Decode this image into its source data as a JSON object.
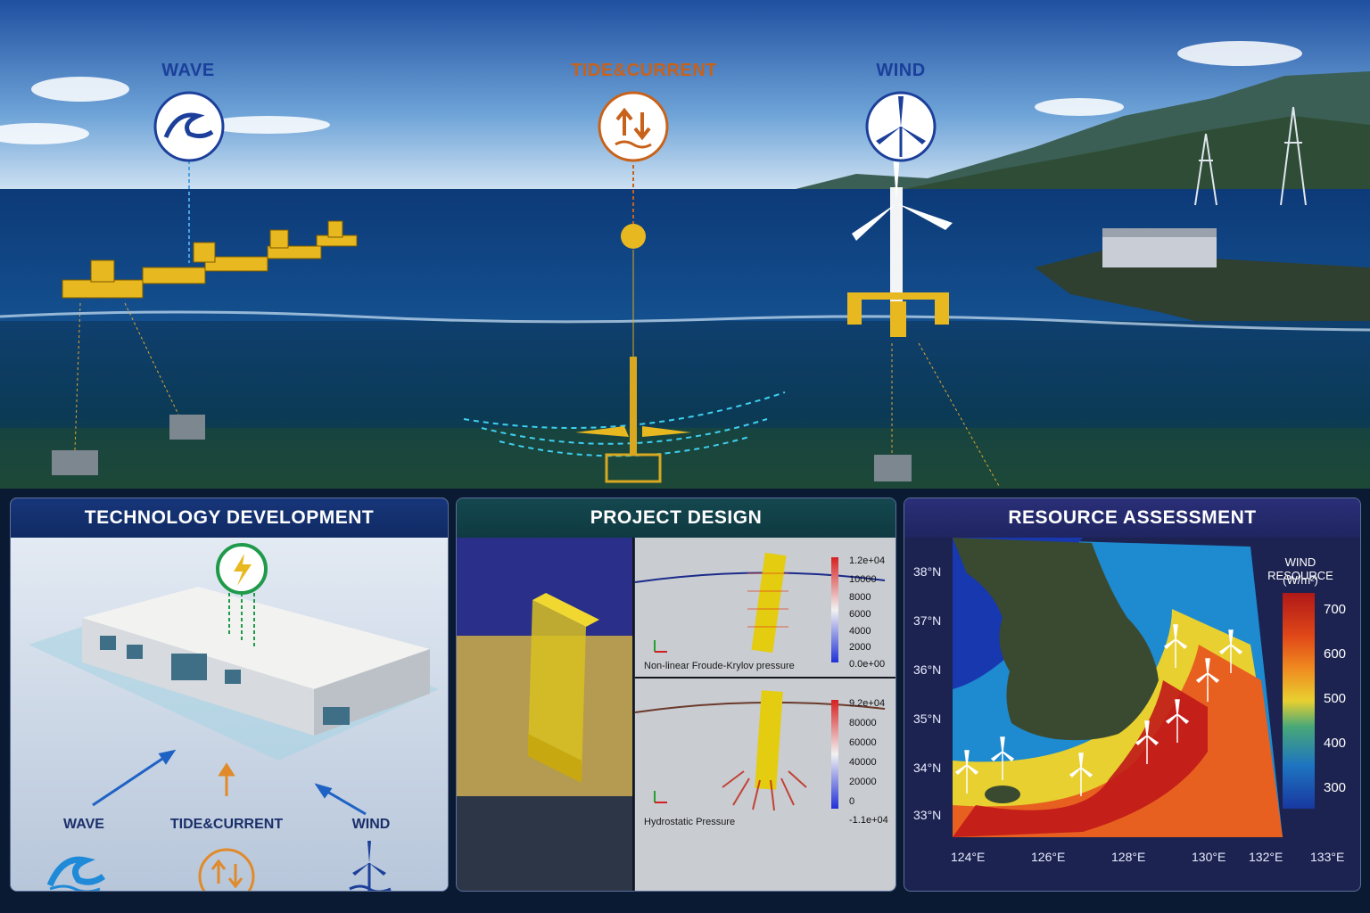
{
  "scene": {
    "labels": {
      "wave": "WAVE",
      "tide": "TIDE&CURRENT",
      "wind": "WIND"
    },
    "icons": [
      "wave-icon",
      "tide-current-icon",
      "wind-turbine-icon"
    ],
    "colors": {
      "wave": "#1b3f9a",
      "tide": "#c8621a",
      "wind": "#1b3f9a"
    }
  },
  "panels": {
    "tech": {
      "title": "TECHNOLOGY DEVELOPMENT",
      "labels": {
        "wave": "WAVE",
        "tide": "TIDE&CURRENT",
        "wind": "WIND"
      }
    },
    "design": {
      "title": "PROJECT DESIGN",
      "top_caption": "Non-linear Froude-Krylov pressure",
      "bottom_caption": "Hydrostatic Pressure",
      "top_colorbar": [
        "1.2e+04",
        "10000",
        "8000",
        "6000",
        "4000",
        "2000",
        "0.0e+00"
      ],
      "bottom_colorbar": [
        "9.2e+04",
        "80000",
        "60000",
        "40000",
        "20000",
        "0",
        "-1.1e+04"
      ]
    },
    "resource": {
      "title": "RESOURCE ASSESSMENT",
      "legend_title_1": "WIND RESOURCE",
      "legend_title_2": "(W/m²)",
      "legend_ticks": [
        "700",
        "600",
        "500",
        "400",
        "300"
      ],
      "lat_ticks": [
        "38°N",
        "37°N",
        "36°N",
        "35°N",
        "34°N",
        "33°N"
      ],
      "lon_ticks": [
        "124°E",
        "126°E",
        "128°E",
        "130°E",
        "132°E",
        "133°E"
      ]
    }
  }
}
